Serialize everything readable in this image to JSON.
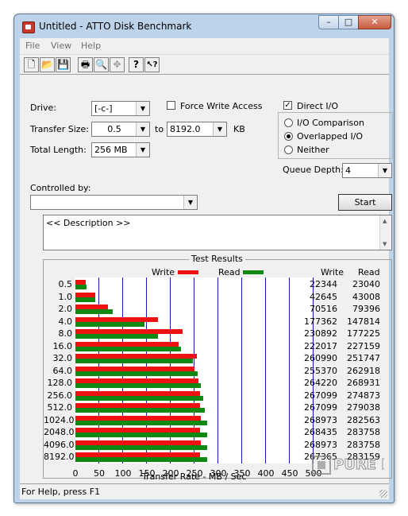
{
  "window": {
    "title": "Untitled - ATTO Disk Benchmark",
    "min_glyph": "–",
    "max_glyph": "□",
    "close_glyph": "✕"
  },
  "menu": [
    "File",
    "View",
    "Help"
  ],
  "toolbar": {
    "new_glyph": "🗋",
    "open_glyph": "📂",
    "save_glyph": "💾",
    "print_glyph": "🖶",
    "preview_glyph": "🔍",
    "move_glyph": "✥",
    "help_glyph": "?",
    "context_help_glyph": "↖?"
  },
  "form": {
    "drive_label": "Drive:",
    "drive_value": "[-c-]",
    "force_write_label": "Force Write Access",
    "force_write_checked": false,
    "direct_io_label": "Direct I/O",
    "direct_io_checked": true,
    "transfer_size_label": "Transfer Size:",
    "transfer_from": "0.5",
    "to_label": "to",
    "transfer_to": "8192.0",
    "kb_label": "KB",
    "total_length_label": "Total Length:",
    "total_length_value": "256 MB",
    "io_comparison_label": "I/O Comparison",
    "overlapped_io_label": "Overlapped I/O",
    "neither_label": "Neither",
    "selected_mode": "Overlapped I/O",
    "queue_depth_label": "Queue Depth:",
    "queue_depth_value": "4",
    "controlled_by_label": "Controlled by:",
    "controlled_by_value": "",
    "start_label": "Start",
    "description_text": "<< Description >>"
  },
  "results": {
    "group_title": "Test Results",
    "write_legend": "Write",
    "read_legend": "Read",
    "col_write": "Write",
    "col_read": "Read",
    "x_axis_label": "Transfer Rate - MB / Sec",
    "colors": {
      "write": "#ee1111",
      "read": "#118811",
      "grid": "#1a1ab4"
    }
  },
  "chart_data": {
    "type": "bar",
    "orientation": "horizontal",
    "categories": [
      "0.5",
      "1.0",
      "2.0",
      "4.0",
      "8.0",
      "16.0",
      "32.0",
      "64.0",
      "128.0",
      "256.0",
      "512.0",
      "1024.0",
      "2048.0",
      "4096.0",
      "8192.0"
    ],
    "series": [
      {
        "name": "Write",
        "values": [
          22344,
          42645,
          70516,
          177362,
          230892,
          222017,
          260990,
          255370,
          264220,
          267099,
          267099,
          268973,
          268435,
          268973,
          267365
        ]
      },
      {
        "name": "Read",
        "values": [
          23040,
          43008,
          79396,
          147814,
          177225,
          227159,
          251747,
          262918,
          268931,
          274873,
          279038,
          282563,
          283758,
          283758,
          283159
        ]
      }
    ],
    "xlabel": "Transfer Rate - MB / Sec",
    "ylabel": "",
    "xlim": [
      0,
      500
    ],
    "xticks": [
      "0",
      "50",
      "100",
      "150",
      "200",
      "250",
      "300",
      "350",
      "400",
      "450",
      "500"
    ],
    "grid": true,
    "legend": "top"
  },
  "statusbar": {
    "text": "For Help, press F1"
  },
  "watermark": {
    "text": "PURE PC"
  }
}
